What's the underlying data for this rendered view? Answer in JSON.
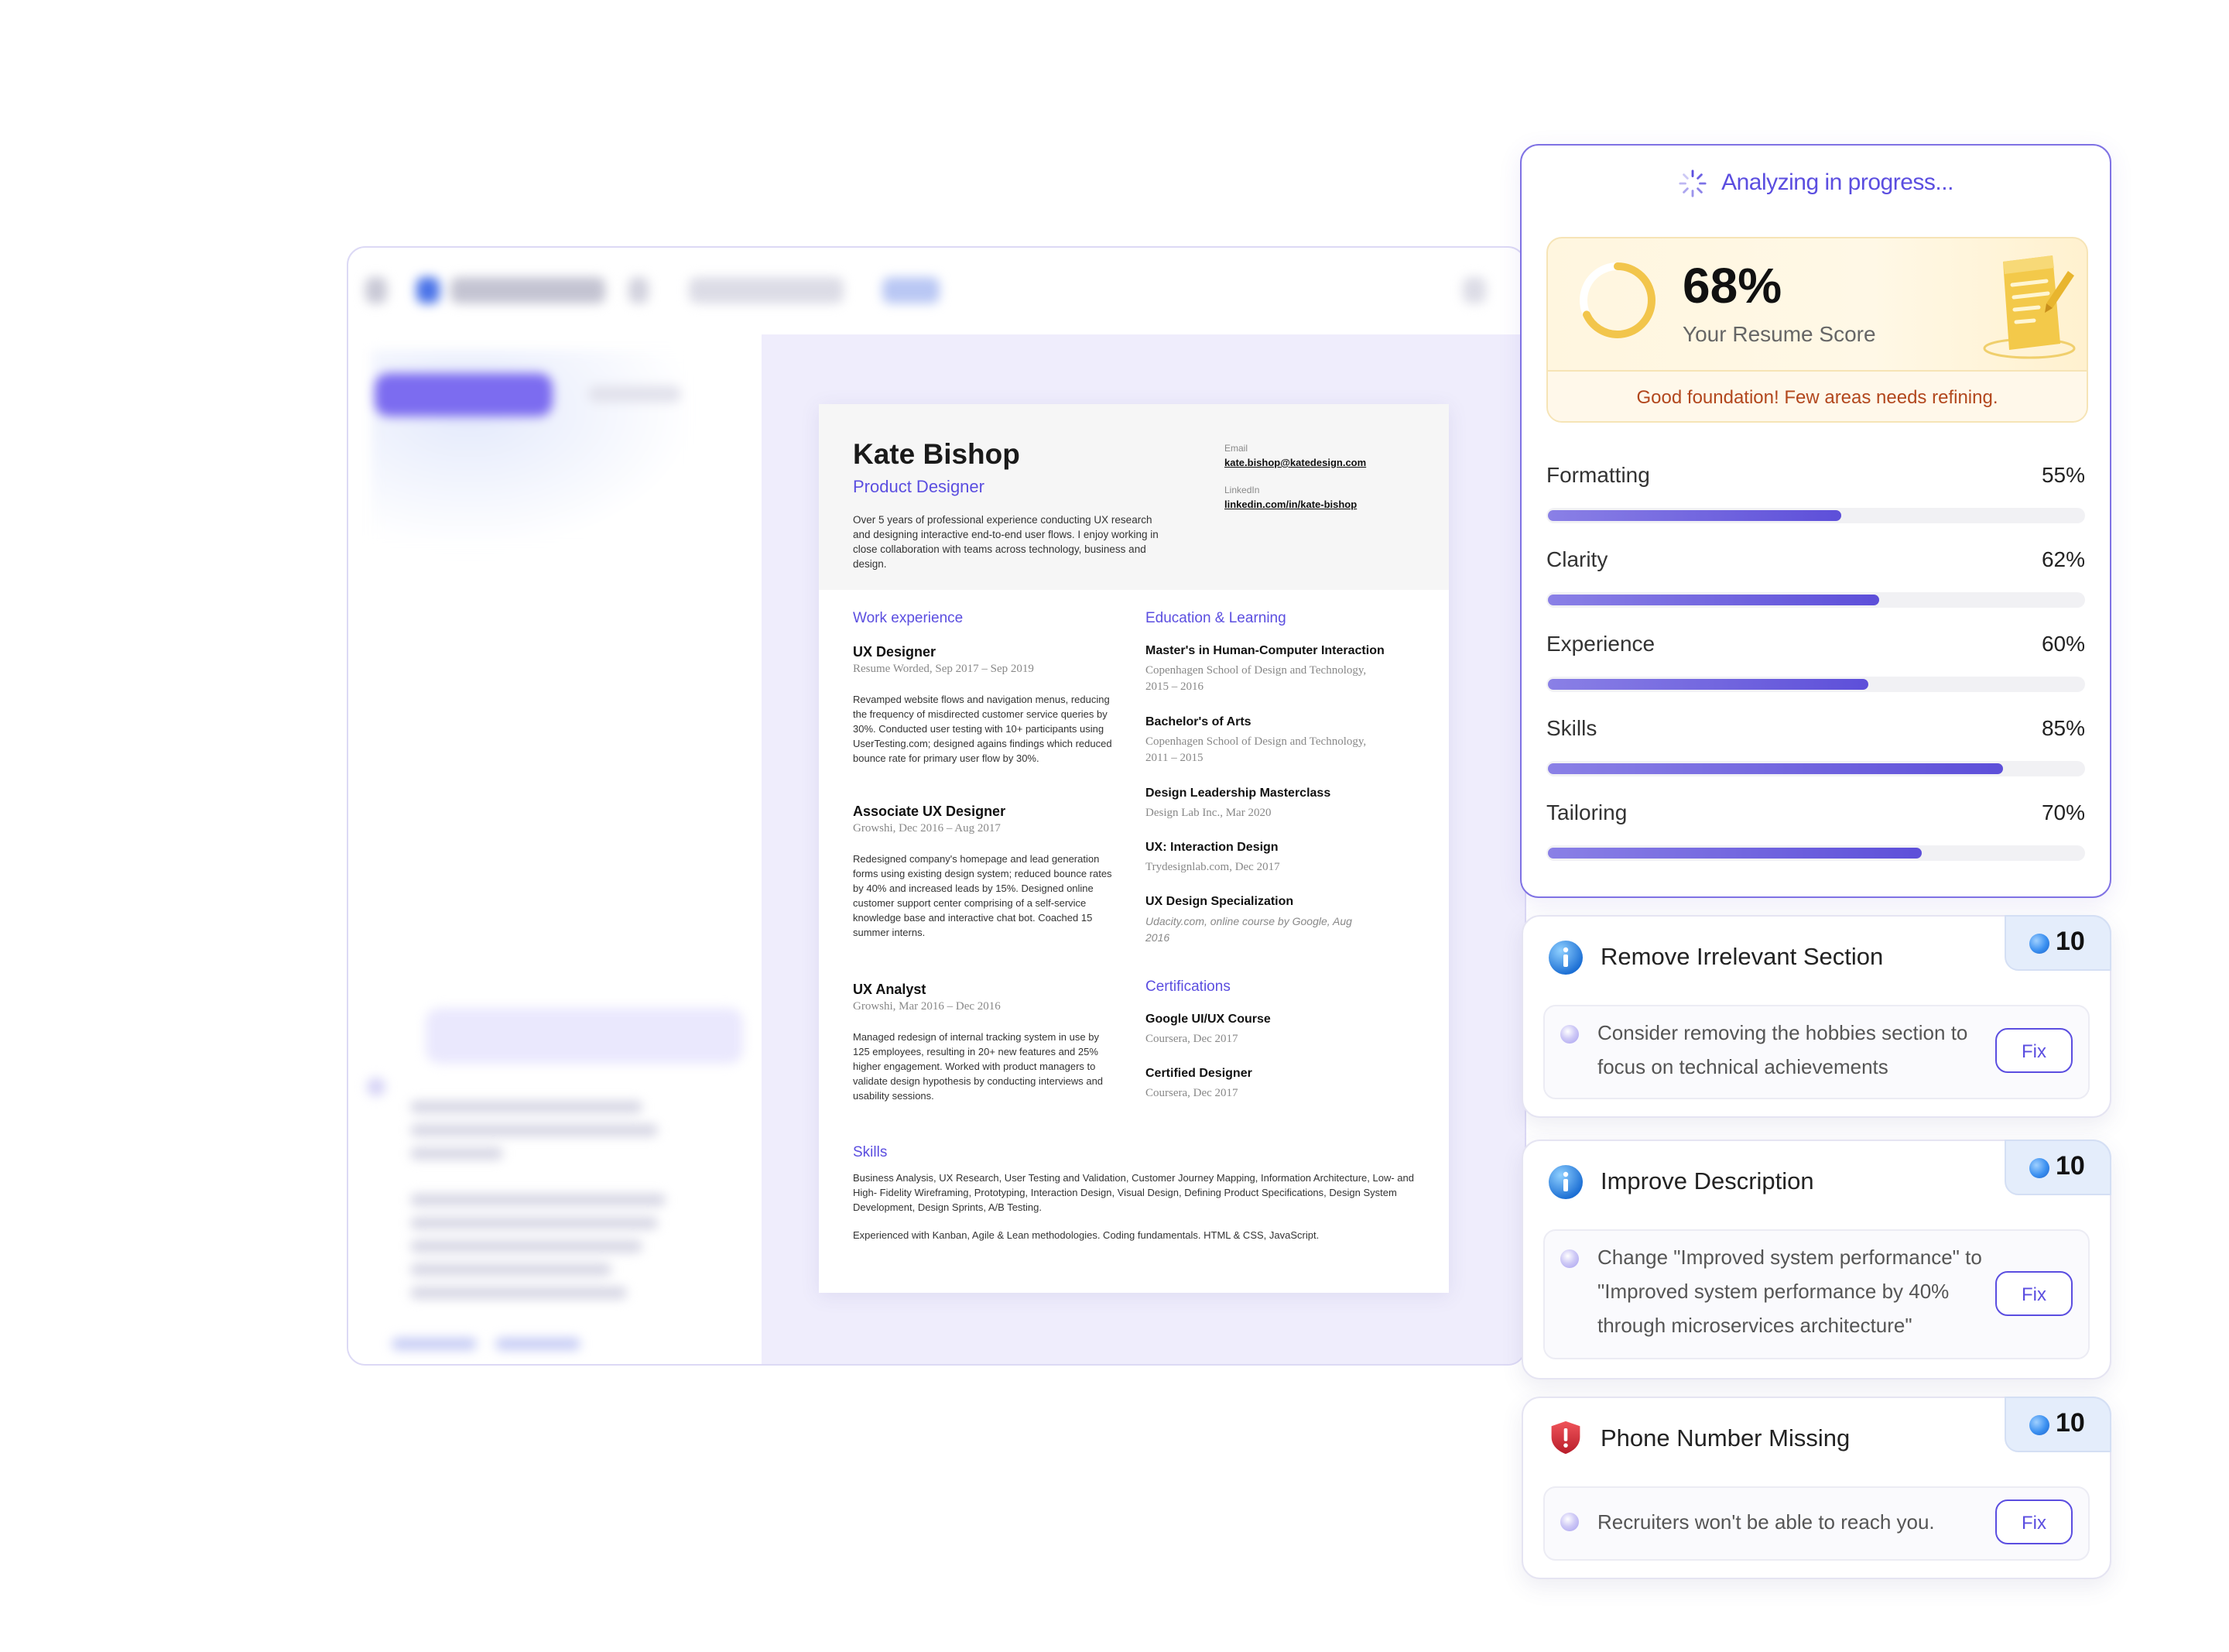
{
  "resume": {
    "name": "Kate Bishop",
    "role": "Product Designer",
    "summary": "Over 5 years of professional experience conducting UX research and designing interactive end-to-end user flows. I enjoy working in close collaboration with teams across technology, business and design.",
    "contact": {
      "email_label": "Email",
      "email": "kate.bishop@katedesign.com",
      "linkedin_label": "LinkedIn",
      "linkedin": "linkedin.com/in/kate-bishop"
    },
    "work_heading": "Work experience",
    "work": [
      {
        "title": "UX Designer",
        "sub": "Resume Worded, Sep 2017 – Sep 2019",
        "body": "Revamped website flows and navigation menus, reducing the frequency of misdirected customer service queries by 30%. Conducted user testing with 10+ participants using UserTesting.com; designed agains findings which reduced bounce rate for primary user flow by 30%."
      },
      {
        "title": "Associate UX Designer",
        "sub": "Growshi, Dec 2016 – Aug 2017",
        "body": "Redesigned company's homepage and lead generation forms using existing design system; reduced bounce rates by 40% and increased leads by 15%. Designed online customer support center comprising of a self-service knowledge base and interactive chat bot. Coached 15 summer interns."
      },
      {
        "title": "UX Analyst",
        "sub": "Growshi, Mar 2016 – Dec 2016",
        "body": "Managed redesign of internal tracking system in use by 125 employees, resulting in 20+ new features and 25% higher engagement. Worked with product managers to validate design hypothesis by conducting interviews and usability sessions."
      }
    ],
    "education_heading": "Education & Learning",
    "education": [
      {
        "title": "Master's in Human-Computer Interaction",
        "sub": "Copenhagen School of Design and Technology, 2015 – 2016"
      },
      {
        "title": "Bachelor's of Arts",
        "sub": "Copenhagen School of Design and Technology, 2011 – 2015"
      },
      {
        "title": "Design Leadership Masterclass",
        "sub": "Design Lab Inc., Mar 2020"
      },
      {
        "title": "UX: Interaction Design",
        "sub": "Trydesignlab.com, Dec 2017"
      },
      {
        "title": "UX Design Specialization",
        "sub": "Udacity.com, online course by Google, Aug 2016"
      }
    ],
    "certifications_heading": "Certifications",
    "certifications": [
      {
        "title": "Google UI/UX Course",
        "sub": "Coursera, Dec 2017"
      },
      {
        "title": "Certified Designer",
        "sub": "Coursera, Dec 2017"
      }
    ],
    "skills_heading": "Skills",
    "skills": "Business Analysis, UX Research, User Testing and Validation, Customer Journey Mapping, Information Architecture, Low- and High- Fidelity Wireframing, Prototyping, Interaction Design, Visual Design, Defining Product Specifications, Design System Development, Design Sprints, A/B Testing.",
    "skills_extra": "Experienced with Kanban, Agile & Lean methodologies. Coding fundamentals. HTML & CSS, JavaScript."
  },
  "analysis": {
    "status": "Analyzing in progress...",
    "score": "68%",
    "score_fraction": 0.68,
    "score_label": "Your Resume Score",
    "score_message": "Good foundation! Few areas needs refining.",
    "metrics": [
      {
        "label": "Formatting",
        "value": "55%",
        "fraction": 0.55
      },
      {
        "label": "Clarity",
        "value": "62%",
        "fraction": 0.62
      },
      {
        "label": "Experience",
        "value": "60%",
        "fraction": 0.6
      },
      {
        "label": "Skills",
        "value": "85%",
        "fraction": 0.85
      },
      {
        "label": "Tailoring",
        "value": "70%",
        "fraction": 0.7
      }
    ]
  },
  "suggestions": [
    {
      "icon": "info-icon",
      "title": "Remove Irrelevant Section",
      "points": "10",
      "text": "Consider removing the hobbies section to focus on technical achievements",
      "fix_label": "Fix"
    },
    {
      "icon": "info-icon",
      "title": "Improve Description",
      "points": "10",
      "text": "Change \"Improved system performance\" to \"Improved system performance by 40% through microservices architecture\"",
      "fix_label": "Fix"
    },
    {
      "icon": "shield-alert-icon",
      "title": "Phone Number Missing",
      "points": "10",
      "text": "Recruiters won't be able to reach you.",
      "fix_label": "Fix"
    }
  ],
  "colors": {
    "accent": "#5b4ee0",
    "bar_start": "#8a80e6",
    "bar_end": "#5d4fd9",
    "warning_text": "#b2471d",
    "gauge": "#f2c54b"
  }
}
